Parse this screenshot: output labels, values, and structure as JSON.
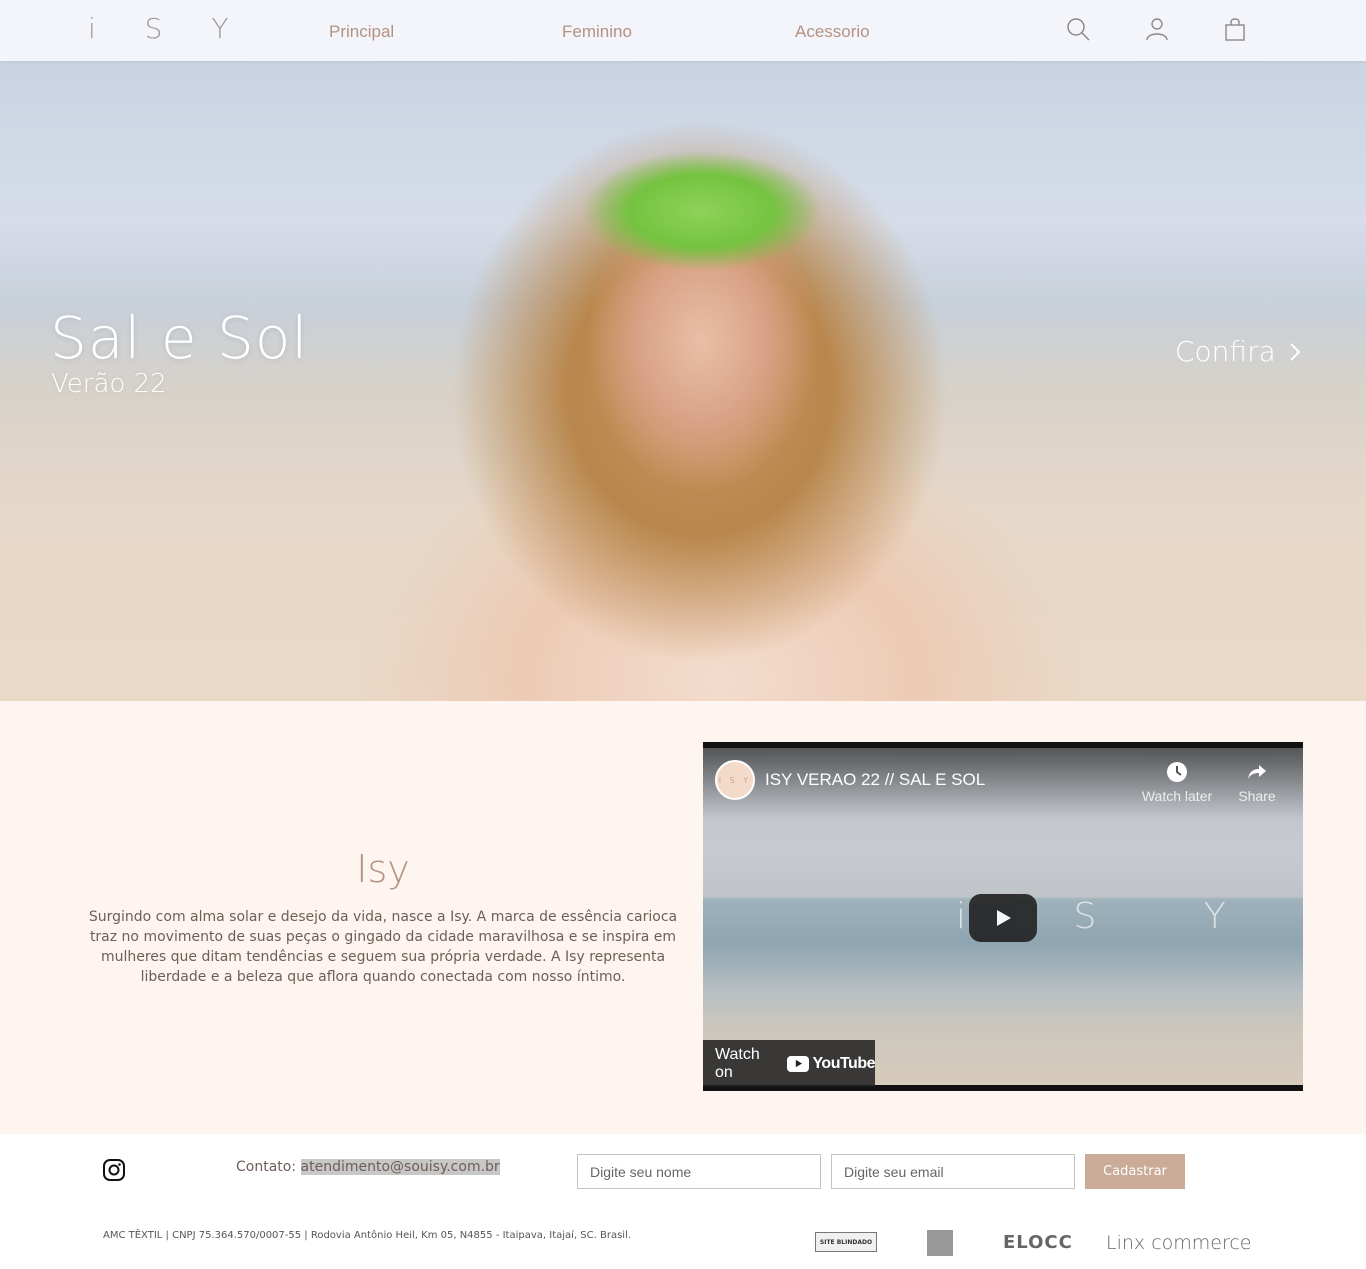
{
  "header": {
    "logo": "i S Y",
    "nav": [
      {
        "label": "Principal"
      },
      {
        "label": "Feminino"
      },
      {
        "label": "Acessorio"
      }
    ],
    "icons": [
      "search-icon",
      "user-icon",
      "shopping-bag-icon"
    ]
  },
  "hero": {
    "title": "Sal e Sol",
    "subtitle": "Verão 22",
    "cta": "Confira"
  },
  "about": {
    "title": "Isy",
    "text": "Surgindo com alma solar e desejo da vida, nasce a Isy. A marca de essência carioca traz no movimento de suas peças o gingado da cidade maravilhosa e se inspira em mulheres que ditam tendências e seguem sua própria verdade. A Isy representa liberdade e a beleza que aflora quando conectada com nosso íntimo."
  },
  "video": {
    "avatar_text": "I S Y",
    "title": "ISY VERAO 22 // SAL E SOL",
    "watch_later": "Watch later",
    "share": "Share",
    "watermark": "i S Y",
    "watch_on": "Watch on",
    "youtube": "YouTube"
  },
  "footer": {
    "contact_label": "Contato:",
    "contact_email": "atendimento@souisy.com.br",
    "name_placeholder": "Digite seu nome",
    "email_placeholder": "Digite seu email",
    "submit_label": "Cadastrar",
    "legal": "AMC TÊXTIL | CNPJ 75.364.570/0007-55 | Rodovia Antônio Heil, Km 05, N4855 - Itaipava, Itajaí, SC. Brasil.",
    "badges": {
      "blindado": "SITE BLINDADO",
      "elocc": "ELOCC",
      "linx": "Linx commerce"
    }
  },
  "colors": {
    "accent": "#b39282",
    "button": "#c9ab98",
    "section_bg": "#fef5f0",
    "header_bg": "#f4f5fa"
  }
}
